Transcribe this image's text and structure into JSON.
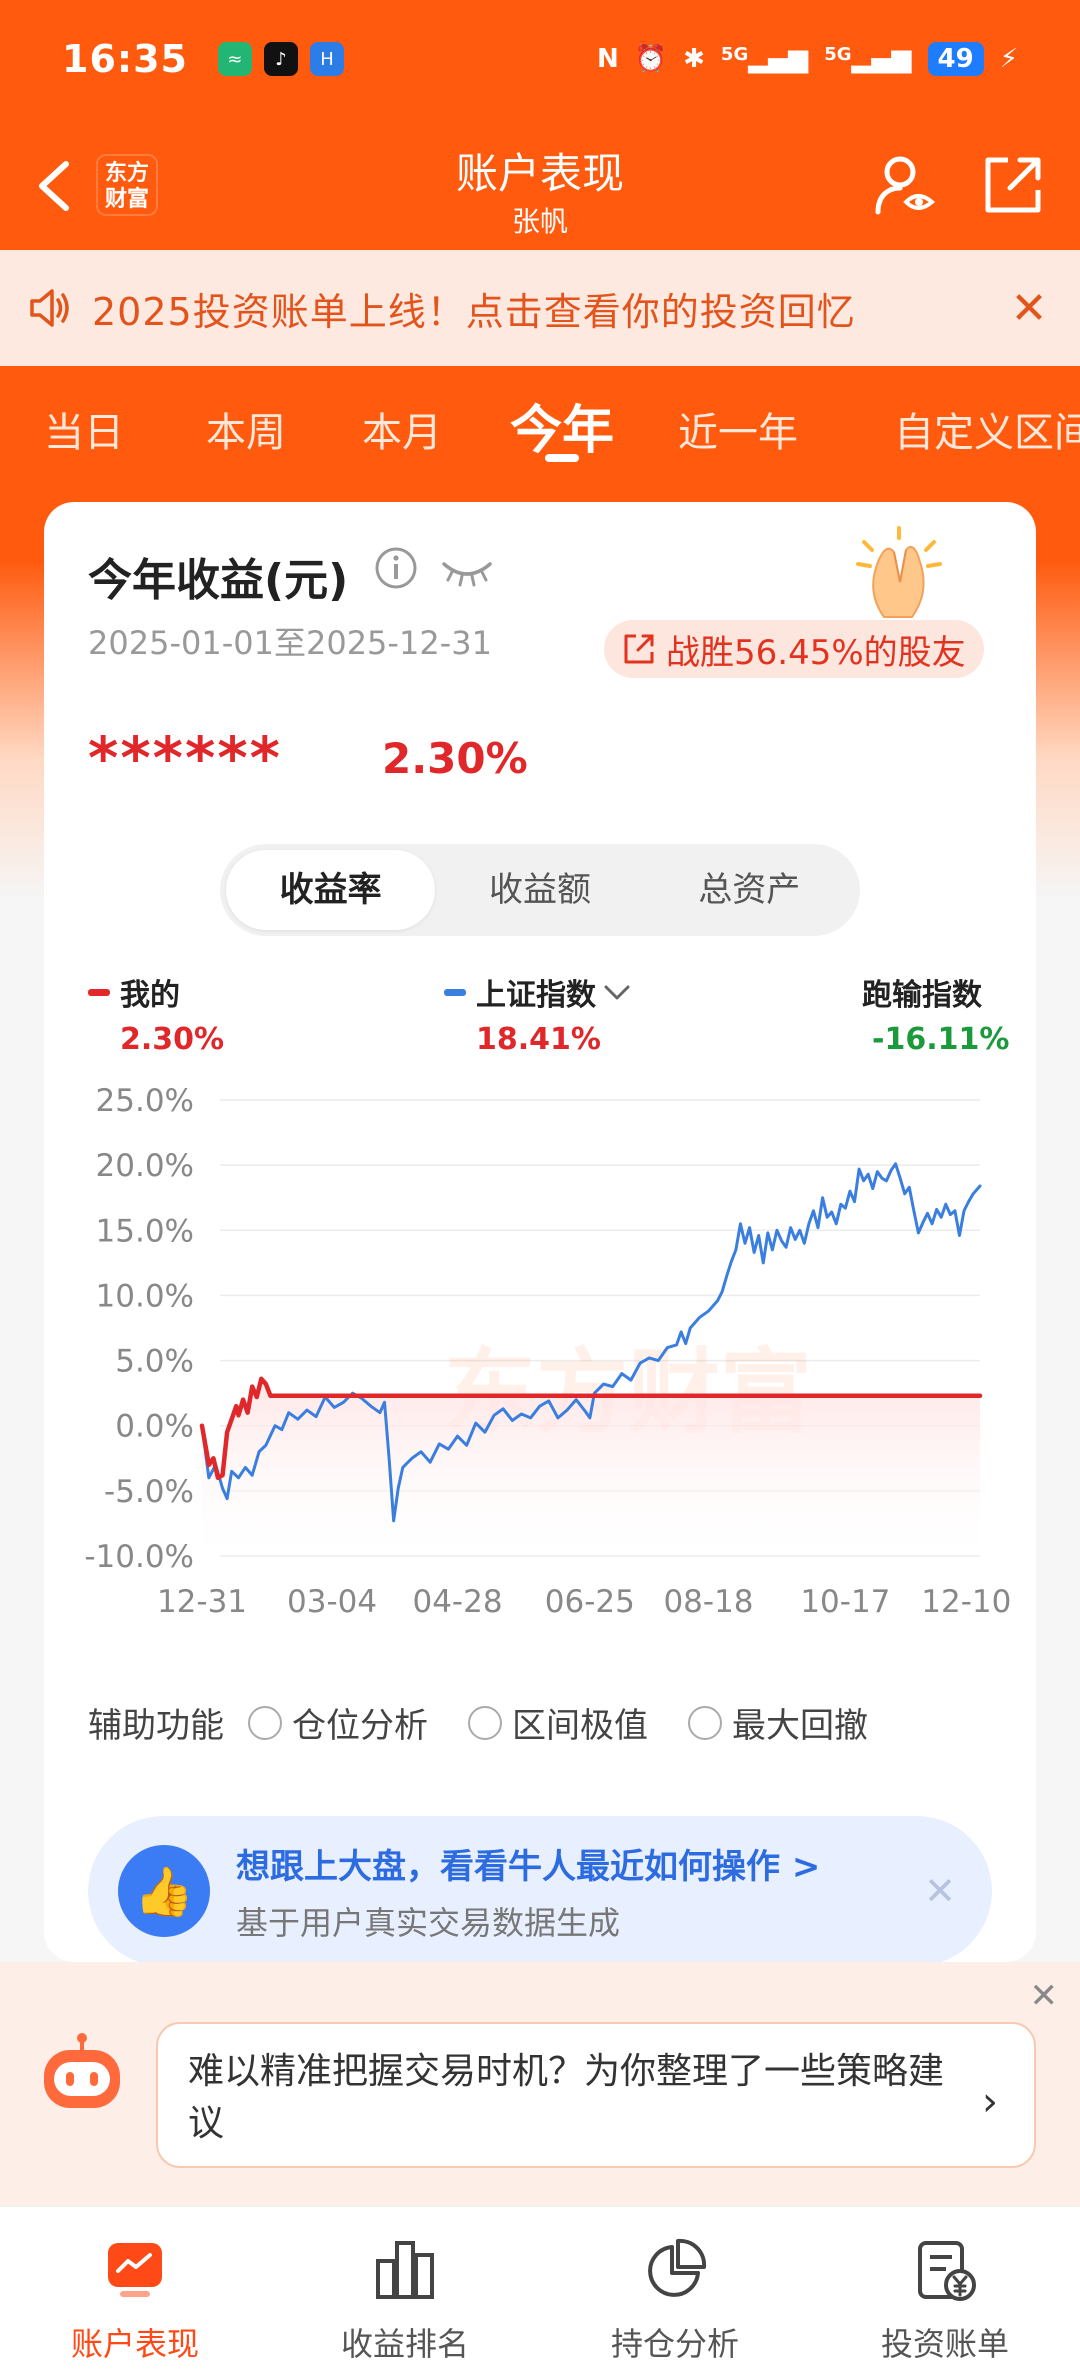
{
  "status_bar": {
    "time": "16:35",
    "signal_a": "5G",
    "signal_b": "5G",
    "battery": "49"
  },
  "header": {
    "logo_text": "东方\n财富",
    "title": "账户表现",
    "subtitle": "张帆"
  },
  "notice": {
    "text": "2025投资账单上线！点击查看你的投资回忆"
  },
  "period_tabs": [
    "当日",
    "本周",
    "本月",
    "今年",
    "近一年",
    "自定义区间"
  ],
  "active_tab": "今年",
  "card": {
    "title": "今年收益(元)",
    "date_range": "2025-01-01至2025-12-31",
    "beat_text": "战胜56.45%的股友",
    "masked_amount": "******",
    "yield_pct": "2.30%",
    "segments": [
      "收益率",
      "收益额",
      "总资产"
    ],
    "active_segment": "收益率",
    "legend": {
      "mine_label": "我的",
      "mine_value": "2.30%",
      "index_label": "上证指数",
      "index_value": "18.41%",
      "outperform_label": "跑输指数",
      "outperform_value": "-16.11%"
    },
    "aux": {
      "label": "辅助功能",
      "options": [
        "仓位分析",
        "区间极值",
        "最大回撤"
      ]
    },
    "promo": {
      "title": "想跟上大盘，看看牛人最近如何操作 >",
      "subtitle": "基于用户真实交易数据生成"
    }
  },
  "chart_data": {
    "type": "line",
    "watermark": "东方财富",
    "x_ticks": [
      "12-31",
      "03-04",
      "04-28",
      "06-25",
      "08-18",
      "10-17",
      "12-10"
    ],
    "y_ticks": [
      "25.0%",
      "20.0%",
      "15.0%",
      "10.0%",
      "5.0%",
      "0.0%",
      "-5.0%",
      "-10.0%"
    ],
    "ylim": [
      -10,
      25
    ],
    "series": [
      {
        "name": "我的",
        "color": "#e0282b",
        "points": [
          [
            0,
            0
          ],
          [
            3,
            -3
          ],
          [
            5,
            -2.5
          ],
          [
            7,
            -4
          ],
          [
            9,
            -3.8
          ],
          [
            11,
            -0.5
          ],
          [
            13,
            0.5
          ],
          [
            15,
            1.5
          ],
          [
            16,
            0.8
          ],
          [
            18,
            2.0
          ],
          [
            20,
            1.0
          ],
          [
            22,
            3.0
          ],
          [
            24,
            2.2
          ],
          [
            26,
            3.6
          ],
          [
            28,
            3.2
          ],
          [
            30,
            2.3
          ],
          [
            80,
            2.3
          ],
          [
            200,
            2.3
          ],
          [
            341,
            2.3
          ]
        ]
      },
      {
        "name": "上证指数",
        "color": "#3a7ee0",
        "points": [
          [
            0,
            0
          ],
          [
            3,
            -4
          ],
          [
            6,
            -3
          ],
          [
            9,
            -4.8
          ],
          [
            11,
            -5.6
          ],
          [
            13,
            -3.5
          ],
          [
            16,
            -4
          ],
          [
            19,
            -3.2
          ],
          [
            22,
            -3.8
          ],
          [
            25,
            -2
          ],
          [
            28,
            -1.5
          ],
          [
            32,
            0
          ],
          [
            35,
            -0.3
          ],
          [
            38,
            1
          ],
          [
            42,
            0.5
          ],
          [
            46,
            1.2
          ],
          [
            50,
            0.7
          ],
          [
            54,
            2.2
          ],
          [
            58,
            1.4
          ],
          [
            62,
            1.8
          ],
          [
            66,
            2.5
          ],
          [
            70,
            2.1
          ],
          [
            74,
            1.5
          ],
          [
            78,
            1.0
          ],
          [
            80,
            1.8
          ],
          [
            82,
            -2.5
          ],
          [
            84,
            -7.3
          ],
          [
            86,
            -4.8
          ],
          [
            88,
            -3.2
          ],
          [
            92,
            -2.5
          ],
          [
            96,
            -2.0
          ],
          [
            100,
            -2.8
          ],
          [
            104,
            -1.4
          ],
          [
            108,
            -1.8
          ],
          [
            112,
            -0.8
          ],
          [
            116,
            -1.5
          ],
          [
            120,
            0.2
          ],
          [
            124,
            -0.5
          ],
          [
            128,
            0.8
          ],
          [
            132,
            1.3
          ],
          [
            136,
            0.4
          ],
          [
            140,
            0.9
          ],
          [
            144,
            0.6
          ],
          [
            148,
            1.5
          ],
          [
            152,
            1.9
          ],
          [
            156,
            0.6
          ],
          [
            160,
            1.2
          ],
          [
            164,
            2.0
          ],
          [
            168,
            1.1
          ],
          [
            170,
            0.6
          ],
          [
            172,
            2.5
          ],
          [
            176,
            3.2
          ],
          [
            180,
            3.0
          ],
          [
            184,
            4.0
          ],
          [
            188,
            3.5
          ],
          [
            192,
            4.8
          ],
          [
            196,
            5.2
          ],
          [
            200,
            5.0
          ],
          [
            204,
            6.0
          ],
          [
            208,
            6.2
          ],
          [
            210,
            7.2
          ],
          [
            212,
            6.3
          ],
          [
            214,
            7.5
          ],
          [
            218,
            8.3
          ],
          [
            222,
            8.8
          ],
          [
            226,
            9.6
          ],
          [
            228,
            10.3
          ],
          [
            230,
            11.5
          ],
          [
            232,
            12.6
          ],
          [
            234,
            13.5
          ],
          [
            236,
            15.5
          ],
          [
            238,
            14.0
          ],
          [
            240,
            15.2
          ],
          [
            242,
            13.3
          ],
          [
            244,
            14.6
          ],
          [
            246,
            12.5
          ],
          [
            248,
            14.8
          ],
          [
            250,
            13.5
          ],
          [
            252,
            15.0
          ],
          [
            254,
            14.2
          ],
          [
            256,
            13.7
          ],
          [
            258,
            15.2
          ],
          [
            260,
            14.3
          ],
          [
            262,
            15.0
          ],
          [
            264,
            14.0
          ],
          [
            266,
            15.5
          ],
          [
            268,
            16.5
          ],
          [
            270,
            15.2
          ],
          [
            272,
            17.5
          ],
          [
            274,
            16.0
          ],
          [
            276,
            16.4
          ],
          [
            278,
            15.5
          ],
          [
            280,
            17.0
          ],
          [
            282,
            16.7
          ],
          [
            284,
            18.0
          ],
          [
            286,
            17.2
          ],
          [
            288,
            19.7
          ],
          [
            290,
            18.8
          ],
          [
            292,
            19.3
          ],
          [
            294,
            18.2
          ],
          [
            296,
            19.5
          ],
          [
            298,
            19.0
          ],
          [
            300,
            18.8
          ],
          [
            302,
            19.6
          ],
          [
            304,
            20.1
          ],
          [
            306,
            19.0
          ],
          [
            308,
            17.8
          ],
          [
            310,
            18.3
          ],
          [
            312,
            16.5
          ],
          [
            314,
            14.8
          ],
          [
            316,
            15.6
          ],
          [
            318,
            16.3
          ],
          [
            320,
            15.5
          ],
          [
            322,
            16.6
          ],
          [
            324,
            16.0
          ],
          [
            326,
            17.0
          ],
          [
            328,
            16.2
          ],
          [
            330,
            16.5
          ],
          [
            332,
            14.6
          ],
          [
            334,
            16.5
          ],
          [
            336,
            17.2
          ],
          [
            338,
            17.8
          ],
          [
            340,
            18.2
          ],
          [
            341,
            18.4
          ]
        ]
      }
    ],
    "x_total_days": 341
  },
  "robot_tip": {
    "text": "难以精准把握交易时机？为你整理了一些策略建议"
  },
  "bottom_nav": {
    "items": [
      "账户表现",
      "收益排名",
      "持仓分析",
      "投资账单"
    ],
    "active": "账户表现"
  },
  "colors": {
    "brand": "#ff5a0e",
    "up": "#e0282b",
    "down": "#1a9a3b",
    "index_line": "#3a7ee0"
  }
}
